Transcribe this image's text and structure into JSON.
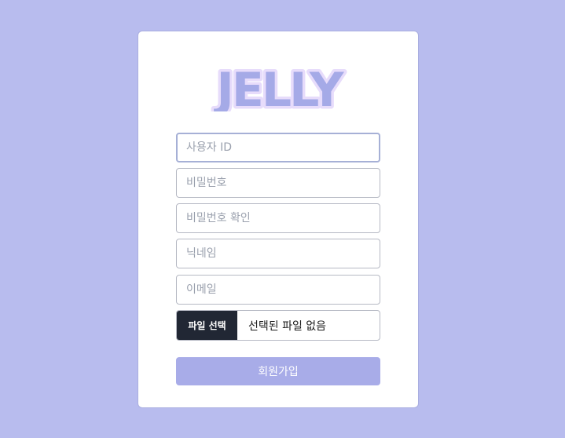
{
  "logo": {
    "text": "JELLY"
  },
  "form": {
    "fields": [
      {
        "placeholder": "사용자 ID",
        "value": ""
      },
      {
        "placeholder": "비밀번호",
        "value": ""
      },
      {
        "placeholder": "비밀번호 확인",
        "value": ""
      },
      {
        "placeholder": "닉네임",
        "value": ""
      },
      {
        "placeholder": "이메일",
        "value": ""
      }
    ],
    "file_button": "파일 선택",
    "file_status": "선택된 파일 없음",
    "submit_label": "회원가입"
  },
  "colors": {
    "background": "#b8bcee",
    "logo_fill": "#a5aae7",
    "logo_outline": "#e7dcfb",
    "submit": "#a8ace8",
    "file_button": "#212734"
  }
}
